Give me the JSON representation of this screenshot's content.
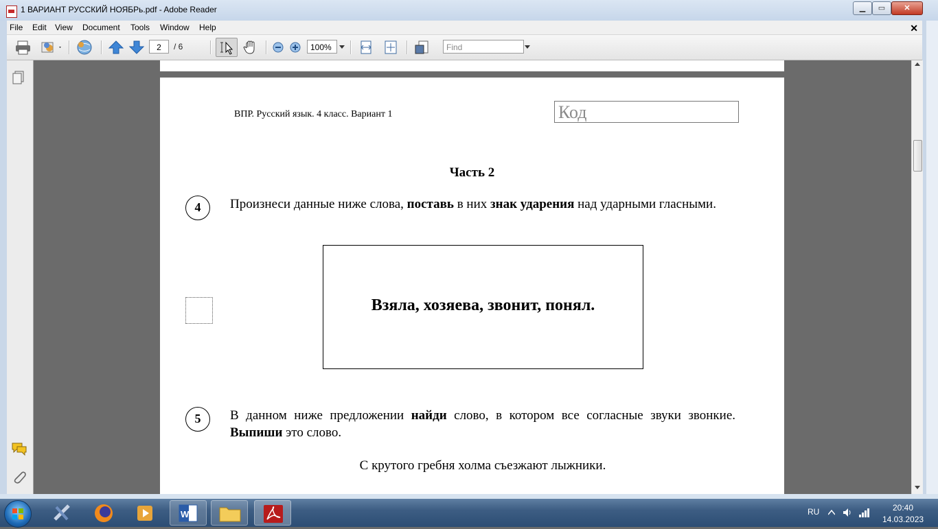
{
  "window": {
    "title": "1 ВАРИАНТ РУССКИЙ НОЯБРь.pdf - Adobe Reader",
    "minimize_glyph": "▁",
    "maximize_glyph": "▭",
    "close_glyph": "✕"
  },
  "menubar": {
    "items": [
      "File",
      "Edit",
      "View",
      "Document",
      "Tools",
      "Window",
      "Help"
    ],
    "close_glyph": "✕"
  },
  "toolbar": {
    "page_current": "2",
    "page_total": "/ 6",
    "zoom": "100%",
    "find_placeholder": "Find"
  },
  "page": {
    "header": "ВПР. Русский язык. 4 класс. Вариант 1",
    "code_label": "Код",
    "part_title": "Часть 2",
    "task4": {
      "number": "4",
      "t1": "Произнеси данные ниже слова, ",
      "b1": "поставь",
      "t2": " в них ",
      "b2": "знак ударения",
      "t3": " над ударными гласными."
    },
    "words": "Взяла, хозяева, звонит, понял.",
    "task5": {
      "number": "5",
      "t1": "В данном ниже предложении ",
      "b1": "найди",
      "t2": " слово, в котором все согласные звуки звонкие. ",
      "b2": "Выпиши",
      "t3": " это слово."
    },
    "sentence": "С крутого гребня холма съезжают лыжники."
  },
  "taskbar": {
    "lang": "RU",
    "time": "20:40",
    "date": "14.03.2023"
  },
  "colors": {
    "accent": "#2c4d74",
    "pdf_red": "#c62b2b"
  }
}
